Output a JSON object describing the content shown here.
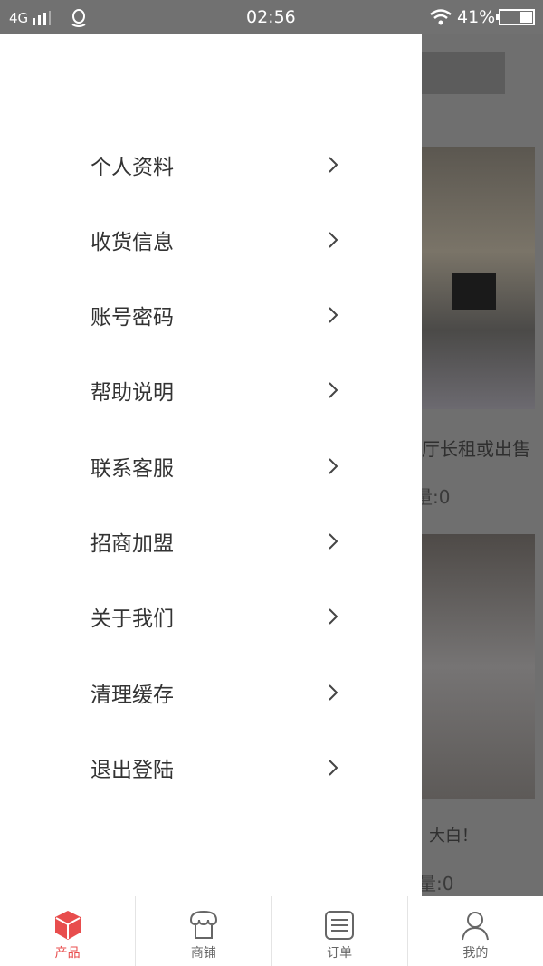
{
  "status_bar": {
    "network": "4G",
    "time": "02:56",
    "battery": "41%"
  },
  "background": {
    "item1_title": "厅长租或出售",
    "item1_count": "量:0",
    "item2_title": "大白！",
    "item2_count": "量:0"
  },
  "drawer": {
    "items": [
      {
        "label": "个人资料"
      },
      {
        "label": "收货信息"
      },
      {
        "label": "账号密码"
      },
      {
        "label": "帮助说明"
      },
      {
        "label": "联系客服"
      },
      {
        "label": "招商加盟"
      },
      {
        "label": "关于我们"
      },
      {
        "label": "清理缓存"
      },
      {
        "label": "退出登陆"
      }
    ]
  },
  "bottom_nav": {
    "active_color": "#e84d4d",
    "tabs": [
      {
        "label": "产品",
        "icon": "cube-icon",
        "active": true
      },
      {
        "label": "商铺",
        "icon": "store-icon"
      },
      {
        "label": "订单",
        "icon": "order-list-icon"
      },
      {
        "label": "我的",
        "icon": "user-icon"
      }
    ]
  }
}
